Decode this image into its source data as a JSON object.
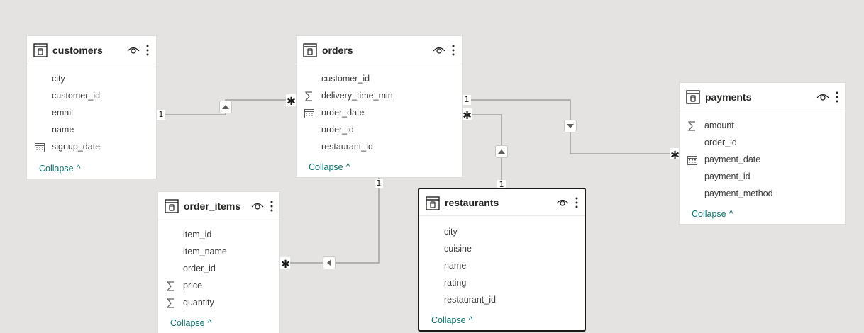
{
  "tables": {
    "customers": {
      "title": "customers",
      "fields": [
        "city",
        "customer_id",
        "email",
        "name",
        "signup_date"
      ],
      "field_icons": [
        "none",
        "none",
        "none",
        "none",
        "calendar-icon"
      ],
      "collapse": "Collapse"
    },
    "orders": {
      "title": "orders",
      "fields": [
        "customer_id",
        "delivery_time_min",
        "order_date",
        "order_id",
        "restaurant_id"
      ],
      "field_icons": [
        "none",
        "sigma-icon",
        "calendar-icon",
        "none",
        "none"
      ],
      "collapse": "Collapse"
    },
    "payments": {
      "title": "payments",
      "fields": [
        "amount",
        "order_id",
        "payment_date",
        "payment_id",
        "payment_method"
      ],
      "field_icons": [
        "sigma-icon",
        "none",
        "calendar-icon",
        "none",
        "none"
      ],
      "collapse": "Collapse"
    },
    "order_items": {
      "title": "order_items",
      "fields": [
        "item_id",
        "item_name",
        "order_id",
        "price",
        "quantity"
      ],
      "field_icons": [
        "none",
        "none",
        "none",
        "sigma-icon",
        "sigma-icon"
      ],
      "collapse": "Collapse"
    },
    "restaurants": {
      "title": "restaurants",
      "fields": [
        "city",
        "cuisine",
        "name",
        "rating",
        "restaurant_id"
      ],
      "field_icons": [
        "none",
        "none",
        "none",
        "none",
        "none"
      ],
      "collapse": "Collapse",
      "selected": true
    }
  },
  "relationships": {
    "one_label": "1",
    "many_label": "∗"
  },
  "colors": {
    "canvas": "#e4e3e1",
    "line": "#a19f9d",
    "collapse_link": "#106e6b"
  }
}
